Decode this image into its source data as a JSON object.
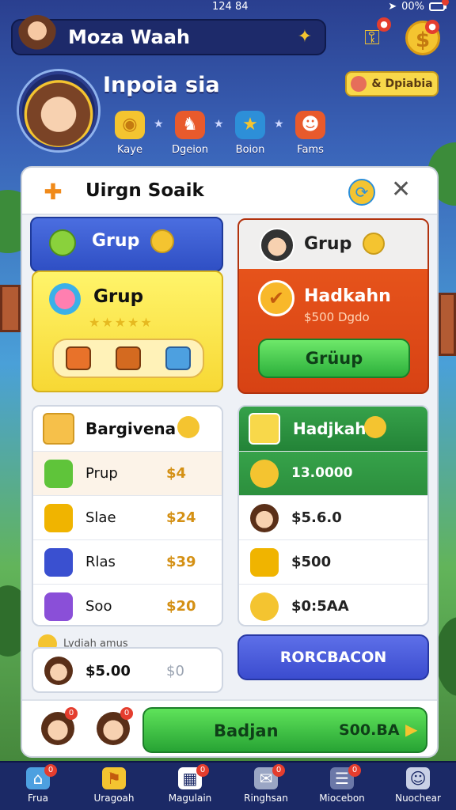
{
  "status_bar": {
    "time": "124 84",
    "battery": "00%"
  },
  "top_bar": {
    "title": "Moza Waah"
  },
  "profile": {
    "name": "Inpoia sia",
    "button_label": "& Dpiabia",
    "stages": [
      {
        "label": "Kaye",
        "icon": "medal-icon",
        "color": "#f4c430"
      },
      {
        "label": "Dgeion",
        "icon": "dragon-icon",
        "color": "#e85a2c"
      },
      {
        "label": "Boion",
        "icon": "star-icon",
        "color": "#2d8fd8"
      },
      {
        "label": "Fams",
        "icon": "monster-icon",
        "color": "#e85a2c"
      }
    ]
  },
  "panel": {
    "title": "Uirgn Soaik",
    "blue_card": {
      "label": "Grup"
    },
    "yellow_card": {
      "label": "Grup",
      "stars": "★★★★★"
    },
    "orange_card": {
      "label": "Grup",
      "title": "Hadkahn",
      "price": "$500 Dgdo",
      "button": "Grüup"
    },
    "left_list": {
      "title": "Bargivena",
      "rows": [
        {
          "name": "Prup",
          "value": "$4",
          "icon_color": "#5fc43a"
        },
        {
          "name": "Slae",
          "value": "$24",
          "icon_color": "#f0b400"
        },
        {
          "name": "Rlas",
          "value": "$39",
          "icon_color": "#3a50d0"
        },
        {
          "name": "Soo",
          "value": "$20",
          "icon_color": "#8a4fd8"
        }
      ]
    },
    "right_list": {
      "title": "Hadjkah",
      "total": "13.0000",
      "rows": [
        {
          "value": "$5.6.0"
        },
        {
          "value": "$500"
        },
        {
          "value": "$0:5AA"
        }
      ]
    },
    "bonus_label": "Lydiah amus",
    "small_card": {
      "value1": "$5.00",
      "value2": "$0"
    },
    "blue_button": "RORCBACON",
    "footer": {
      "badges": [
        "0",
        "0"
      ],
      "green_button_label": "Badjan",
      "green_button_value": "S00.BA"
    }
  },
  "bottom_nav": [
    {
      "label": "Frua",
      "icon": "home-icon",
      "badge": "0"
    },
    {
      "label": "Uragoah",
      "icon": "map-icon",
      "badge": ""
    },
    {
      "label": "Magulain",
      "icon": "calendar-icon",
      "badge": "0"
    },
    {
      "label": "Ringhsan",
      "icon": "chat-icon",
      "badge": "0"
    },
    {
      "label": "Miocebon",
      "icon": "book-icon",
      "badge": "0"
    },
    {
      "label": "Nuochear",
      "icon": "trophy-icon",
      "badge": ""
    }
  ]
}
